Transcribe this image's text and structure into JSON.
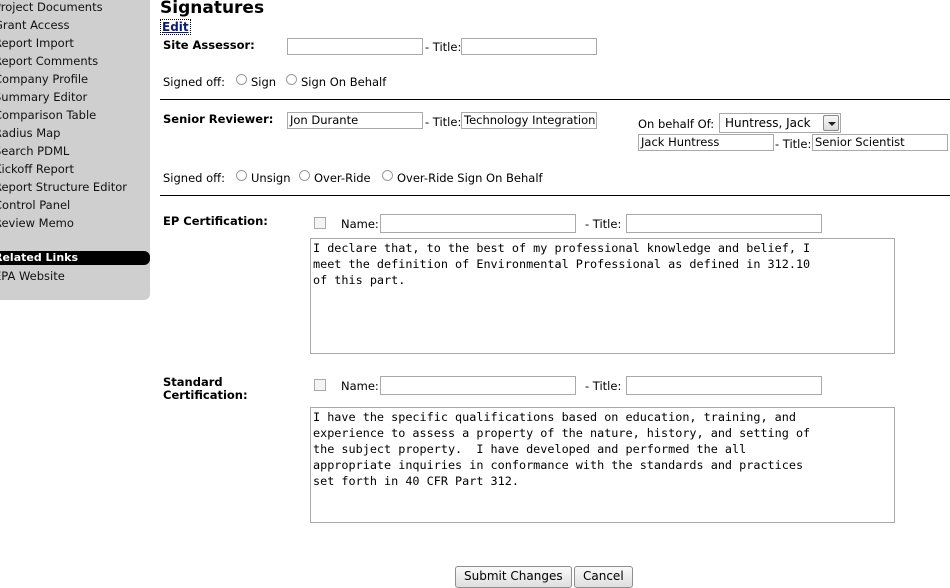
{
  "sidebar": {
    "items": [
      {
        "label": "Project Documents"
      },
      {
        "label": "Grant Access"
      },
      {
        "label": "Report Import"
      },
      {
        "label": "Report Comments"
      },
      {
        "label": "Company Profile"
      },
      {
        "label": "Summary Editor"
      },
      {
        "label": "Comparison Table"
      },
      {
        "label": "Radius Map"
      },
      {
        "label": "Search PDML"
      },
      {
        "label": "Kickoff Report"
      },
      {
        "label": "Report Structure Editor"
      },
      {
        "label": "Control Panel"
      },
      {
        "label": "Review Memo"
      }
    ],
    "related_header": "Related Links",
    "related_items": [
      {
        "label": "EPA Website"
      }
    ]
  },
  "page": {
    "title": "Signatures",
    "edit_link": "Edit"
  },
  "site_assessor": {
    "label": "Site Assessor:",
    "name_value": "",
    "title_label": "- Title:",
    "title_value": "",
    "signed_off_label": "Signed off:",
    "option_sign": "Sign",
    "option_sign_on_behalf": "Sign On Behalf"
  },
  "senior_reviewer": {
    "label": "Senior Reviewer:",
    "name_value": "Jon Durante",
    "title_label": "- Title:",
    "title_value": "Technology Integration",
    "on_behalf_label": "On behalf Of:",
    "on_behalf_selected": "Huntress, Jack",
    "behalf_name_value": "Jack Huntress",
    "behalf_title_label": "- Title:",
    "behalf_title_value": "Senior Scientist",
    "signed_off_label": "Signed off:",
    "option_unsign": "Unsign",
    "option_override": "Over-Ride",
    "option_override_behalf": "Over-Ride Sign On Behalf"
  },
  "ep_certification": {
    "label": "EP Certification:",
    "name_label": "Name:",
    "name_value": "",
    "title_label": "- Title:",
    "title_value": "",
    "text": "I declare that, to the best of my professional knowledge and belief, I\nmeet the definition of Environmental Professional as defined in 312.10\nof this part."
  },
  "standard_certification": {
    "label": "Standard Certification:",
    "name_label": "Name:",
    "name_value": "",
    "title_label": "- Title:",
    "title_value": "",
    "text": "I have the specific qualifications based on education, training, and\nexperience to assess a property of the nature, history, and setting of\nthe subject property.  I have developed and performed the all\nappropriate inquiries in conformance with the standards and practices\nset forth in 40 CFR Part 312."
  },
  "actions": {
    "submit_label": "Submit Changes",
    "cancel_label": "Cancel"
  }
}
